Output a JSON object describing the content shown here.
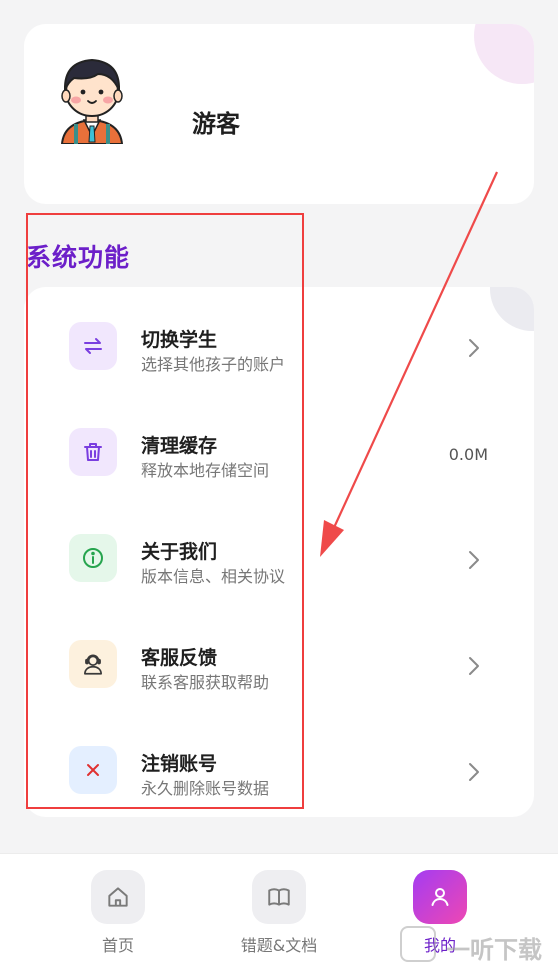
{
  "profile": {
    "username": "游客"
  },
  "section_title": "系统功能",
  "menu": [
    {
      "title": "切换学生",
      "subtitle": "选择其他孩子的账户",
      "icon": "swap-icon",
      "icon_bg": "#f1e7fd"
    },
    {
      "title": "清理缓存",
      "subtitle": "释放本地存储空间",
      "icon": "trash-icon",
      "icon_bg": "#f1e7fd",
      "value": "0.0M"
    },
    {
      "title": "关于我们",
      "subtitle": "版本信息、相关协议",
      "icon": "info-icon",
      "icon_bg": "#e5f7ea"
    },
    {
      "title": "客服反馈",
      "subtitle": "联系客服获取帮助",
      "icon": "support-agent-icon",
      "icon_bg": "#fdf1de"
    },
    {
      "title": "注销账号",
      "subtitle": "永久删除账号数据",
      "icon": "close-icon",
      "icon_bg": "#e4efff"
    }
  ],
  "bottom_nav": [
    {
      "label": "首页",
      "icon": "home-icon"
    },
    {
      "label": "错题&文档",
      "icon": "book-icon"
    },
    {
      "label": "我的",
      "icon": "user-icon",
      "active": true
    }
  ],
  "watermark": {
    "text": "一听下载"
  },
  "colors": {
    "accent": "#6c1fc9",
    "annotation_red": "#ef3e3e",
    "active_gradient_start": "#a43cf2",
    "active_gradient_end": "#ee47b3"
  }
}
